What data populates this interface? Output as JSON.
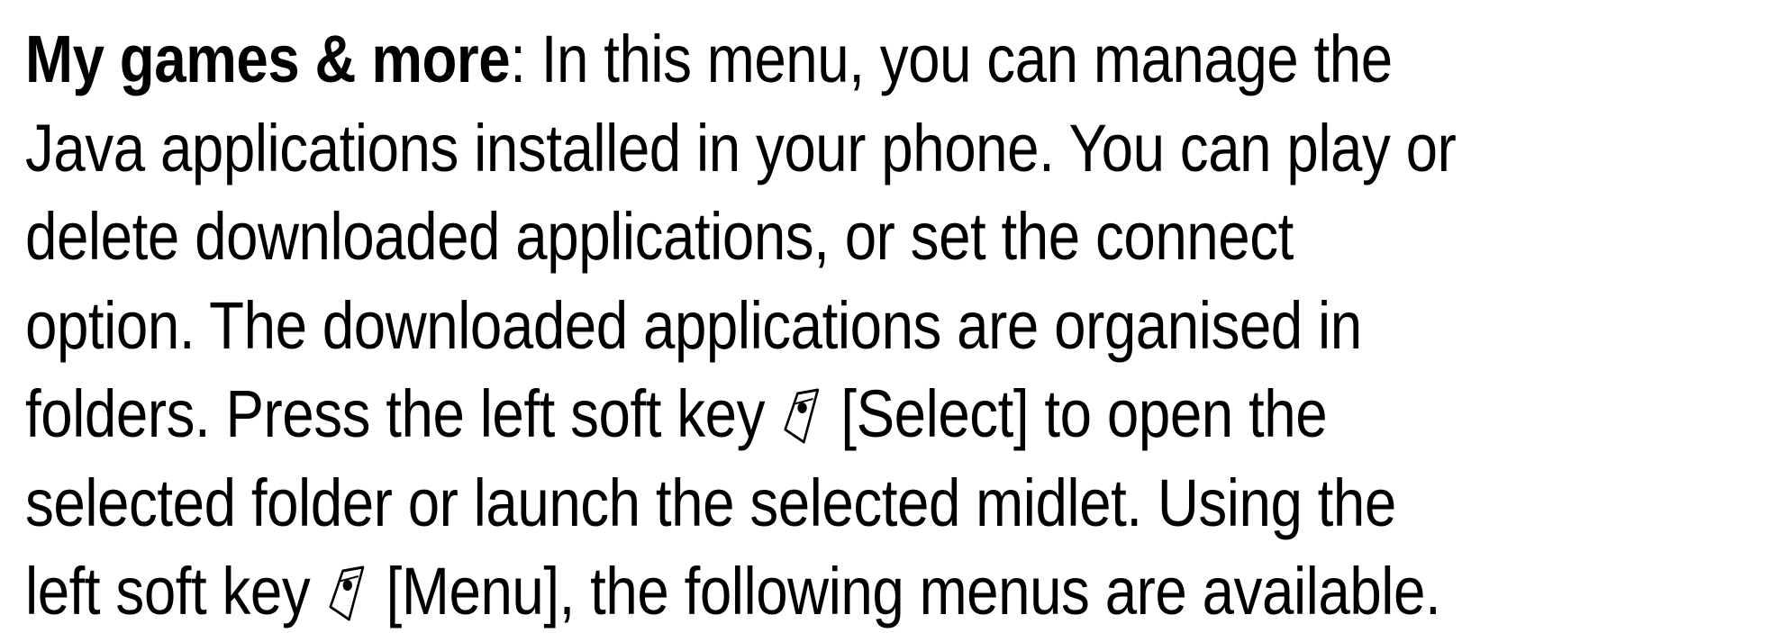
{
  "paragraph": {
    "heading": "My games & more",
    "line1_rest": ": In this menu, you can manage the",
    "line2": "Java applications installed in your phone. You can play or",
    "line3": "delete downloaded applications, or set the connect",
    "line4": "option. The downloaded applications are organised in",
    "line5_before": "folders. Press the left soft key ",
    "line5_after": " [Select] to open the",
    "line6": "selected folder or launch the selected midlet. Using the",
    "line7_before": "left soft key ",
    "line7_after": " [Menu], the following menus are available."
  },
  "icons": {
    "soft_key": "left-soft-key-icon"
  }
}
